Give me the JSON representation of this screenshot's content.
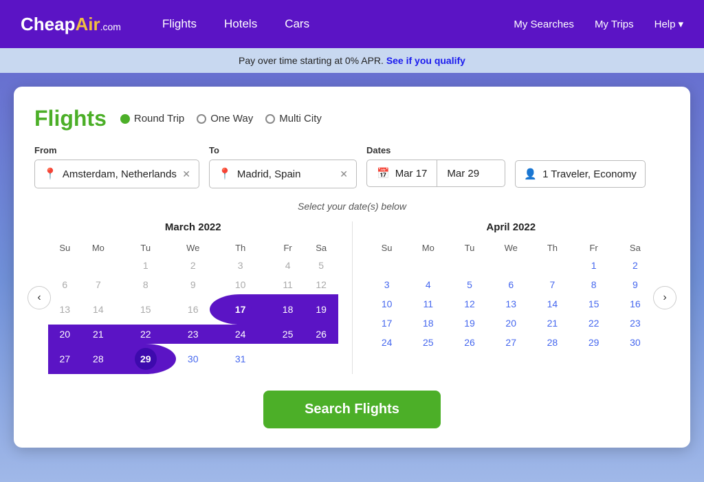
{
  "header": {
    "logo": "CheapAir",
    "logo_suffix": ".com",
    "nav": {
      "flights": "Flights",
      "hotels": "Hotels",
      "cars": "Cars"
    },
    "nav_right": {
      "my_searches": "My Searches",
      "my_trips": "My Trips",
      "help": "Help",
      "help_arrow": "▾"
    }
  },
  "banner": {
    "text": "Pay over time starting at 0% APR.",
    "link_text": "See if you qualify"
  },
  "flights": {
    "title": "Flights",
    "trip_options": [
      {
        "id": "round-trip",
        "label": "Round Trip",
        "active": true
      },
      {
        "id": "one-way",
        "label": "One Way",
        "active": false
      },
      {
        "id": "multi-city",
        "label": "Multi City",
        "active": false
      }
    ],
    "from_label": "From",
    "from_value": "Amsterdam, Netherlands",
    "to_label": "To",
    "to_value": "Madrid, Spain",
    "dates_label": "Dates",
    "date_start": "Mar 17",
    "date_end": "Mar 29",
    "travelers": "1 Traveler, Economy",
    "calendar_hint": "Select your date(s) below",
    "march": {
      "title": "March 2022",
      "days_header": [
        "Su",
        "Mo",
        "Tu",
        "We",
        "Th",
        "Fr",
        "Sa"
      ],
      "weeks": [
        [
          null,
          null,
          1,
          2,
          3,
          4,
          5
        ],
        [
          6,
          7,
          8,
          9,
          10,
          11,
          12
        ],
        [
          13,
          14,
          15,
          16,
          17,
          18,
          19
        ],
        [
          20,
          21,
          22,
          23,
          24,
          25,
          26
        ],
        [
          27,
          28,
          29,
          30,
          31,
          null,
          null
        ]
      ]
    },
    "april": {
      "title": "April 2022",
      "days_header": [
        "Su",
        "Mo",
        "Tu",
        "We",
        "Th",
        "Fr",
        "Sa"
      ],
      "weeks": [
        [
          null,
          null,
          null,
          null,
          null,
          1,
          2
        ],
        [
          3,
          4,
          5,
          6,
          7,
          8,
          9
        ],
        [
          10,
          11,
          12,
          13,
          14,
          15,
          16
        ],
        [
          17,
          18,
          19,
          20,
          21,
          22,
          23
        ],
        [
          24,
          25,
          26,
          27,
          28,
          29,
          30
        ]
      ]
    },
    "search_button": "Search Flights"
  },
  "colors": {
    "brand_purple": "#5b14c5",
    "brand_green": "#4caf28",
    "selected_range": "#5b14c5"
  }
}
